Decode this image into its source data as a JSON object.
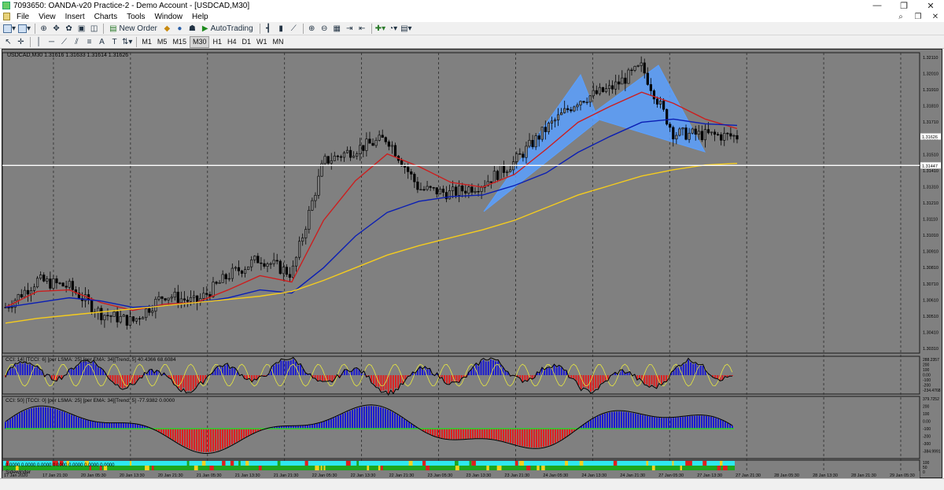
{
  "window": {
    "title": "7093650: OANDA-v20 Practice-2 - Demo Account - [USDCAD,M30]",
    "buttons": [
      "—",
      "❐",
      "✕"
    ]
  },
  "menu": {
    "items": [
      "File",
      "View",
      "Insert",
      "Charts",
      "Tools",
      "Window",
      "Help"
    ],
    "right_icons": [
      "search-icon",
      "restore-icon",
      "close-icon"
    ]
  },
  "toolbar": {
    "new_order_label": "New Order",
    "autotrading_label": "AutoTrading",
    "timeframes": [
      "M1",
      "M5",
      "M15",
      "M30",
      "H1",
      "H4",
      "D1",
      "W1",
      "MN"
    ],
    "active_timeframe": "M30"
  },
  "chart": {
    "header": "USDCAD,M30  1.31616 1.31633 1.31614 1.31626",
    "symbol": "USDCAD",
    "timeframe": "M30",
    "ohlc": {
      "open": "1.31616",
      "high": "1.31633",
      "low": "1.31614",
      "close": "1.31626"
    },
    "bg_color": "#808080",
    "current_price_label": "1.31626",
    "hline_price_label": "1.31447",
    "price_ticks": [
      "1.32110",
      "1.32010",
      "1.31910",
      "1.31810",
      "1.31710",
      "1.31610",
      "1.31510",
      "1.31410",
      "1.31310",
      "1.31210",
      "1.31110",
      "1.31010",
      "1.30910",
      "1.30810",
      "1.30710",
      "1.30610",
      "1.30510",
      "1.30410",
      "1.30310"
    ],
    "time_ticks": [
      "17 Jan 2020",
      "17 Jan 21:30",
      "20 Jan 05:30",
      "20 Jan 13:30",
      "20 Jan 21:30",
      "21 Jan 05:30",
      "21 Jan 13:30",
      "21 Jan 21:30",
      "22 Jan 05:30",
      "22 Jan 13:30",
      "22 Jan 21:30",
      "23 Jan 05:30",
      "23 Jan 13:30",
      "23 Jan 21:30",
      "24 Jan 05:30",
      "24 Jan 13:30",
      "24 Jan 21:30",
      "27 Jan 05:30",
      "27 Jan 13:30",
      "27 Jan 21:30",
      "28 Jan 05:30",
      "28 Jan 13:30",
      "28 Jan 21:30",
      "29 Jan 05:30"
    ],
    "ma_colors": {
      "fast": "#cc1e1e",
      "mid": "#0a1eb4",
      "slow": "#f5cc1e"
    },
    "pattern_color": "#5aa0ff"
  },
  "indicators": [
    {
      "label": "CCI: 14] [TCCI: 6] [per LSMA: 25] [per EMA: 34][Trend: 5]  40.4366 68.6084",
      "ticks": [
        "288.2357",
        "200",
        "100",
        "0.00",
        "-100",
        "-200",
        "-234.4768"
      ]
    },
    {
      "label": "CCI: 50] [TCCI: 0] [per LSMA: 25] [per EMA: 34][Trend: 5]  -77.9382 0.0000",
      "ticks": [
        "379.7252",
        "200",
        "100",
        "0.00",
        "-100",
        "-200",
        "-300",
        "-384.9991"
      ]
    },
    {
      "label": "Sidewinder",
      "values_label": "0.0000 0.0000 0.0000 0.0000 0.0000 0.0000 0.0000",
      "ticks": [
        "100",
        "50",
        "0"
      ]
    }
  ],
  "chart_data": {
    "type": "line",
    "title": "USDCAD,M30",
    "xlabel": "",
    "ylabel": "",
    "ylim": [
      1.3026,
      1.3216
    ],
    "x": [
      "17 Jan 2020",
      "17 Jan 21:30",
      "20 Jan 05:30",
      "20 Jan 13:30",
      "20 Jan 21:30",
      "21 Jan 05:30",
      "21 Jan 13:30",
      "21 Jan 21:30",
      "22 Jan 05:30",
      "22 Jan 13:30",
      "22 Jan 21:30",
      "23 Jan 05:30",
      "23 Jan 13:30",
      "23 Jan 21:30",
      "24 Jan 05:30",
      "24 Jan 13:30",
      "24 Jan 21:30",
      "27 Jan 05:30",
      "27 Jan 13:30",
      "27 Jan 21:30",
      "28 Jan 05:30",
      "28 Jan 13:30",
      "28 Jan 21:30",
      "29 Jan 05:30"
    ],
    "series": [
      {
        "values": [
          1.3055,
          1.3072,
          1.3068,
          1.3051,
          1.3046,
          1.3063,
          1.3058,
          1.3075,
          1.3086,
          1.3076,
          1.3147,
          1.3155,
          1.3162,
          1.313,
          1.3127,
          1.3133,
          1.3147,
          1.3168,
          1.3186,
          1.3193,
          1.3207,
          1.3165,
          1.3164,
          1.3163
        ]
      },
      {
        "values": [
          1.3055,
          1.3065,
          1.3066,
          1.3058,
          1.3053,
          1.3057,
          1.3058,
          1.3066,
          1.3075,
          1.3071,
          1.311,
          1.3135,
          1.3152,
          1.3144,
          1.3134,
          1.3131,
          1.3139,
          1.3155,
          1.3172,
          1.3182,
          1.3191,
          1.3184,
          1.3174,
          1.3168
        ]
      },
      {
        "values": [
          1.3055,
          1.3058,
          1.3061,
          1.3059,
          1.3055,
          1.3056,
          1.3058,
          1.3061,
          1.3066,
          1.3064,
          1.308,
          1.31,
          1.3115,
          1.3122,
          1.3125,
          1.3126,
          1.3132,
          1.314,
          1.3153,
          1.3163,
          1.3172,
          1.3174,
          1.3171,
          1.317
        ]
      },
      {
        "values": [
          1.3045,
          1.3048,
          1.305,
          1.3052,
          1.3054,
          1.3056,
          1.3058,
          1.306,
          1.3062,
          1.3065,
          1.3072,
          1.308,
          1.3088,
          1.3094,
          1.3099,
          1.3104,
          1.311,
          1.3118,
          1.3126,
          1.3132,
          1.3138,
          1.3142,
          1.3145,
          1.3146
        ]
      }
    ],
    "hline": 1.31447,
    "grid": true
  }
}
